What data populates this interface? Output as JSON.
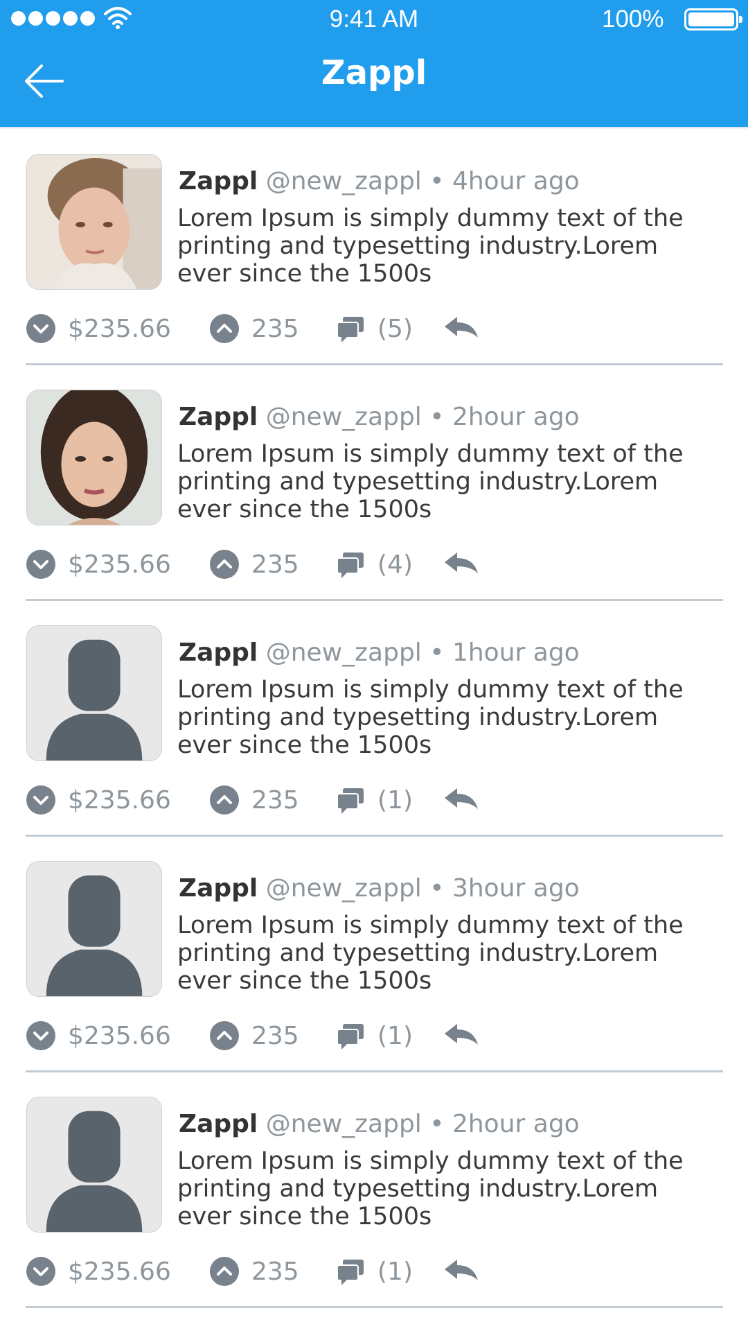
{
  "status_bar": {
    "time": "9:41 AM",
    "battery": "100%",
    "icons": [
      "signal-dots-icon",
      "wifi-icon",
      "battery-icon"
    ]
  },
  "header": {
    "title": "Zappl",
    "back_icon": "arrow-left-icon"
  },
  "colors": {
    "accent": "#219ded",
    "muted": "#8d969d",
    "text": "#3a3a3a",
    "divider": "#c3cbd2"
  },
  "posts": [
    {
      "avatar": "photo-woman-1",
      "name": "Zappl",
      "handle": "@new_zappl",
      "separator": "•",
      "time": "4hour ago",
      "text": "Lorem Ipsum is simply dummy text of the printing and typesetting industry.Lorem ever since the 1500s",
      "price": "$235.66",
      "votes": "235",
      "comments": "(5)"
    },
    {
      "avatar": "photo-woman-2",
      "name": "Zappl",
      "handle": "@new_zappl",
      "separator": "•",
      "time": "2hour ago",
      "text": "Lorem Ipsum is simply dummy text of the printing and typesetting industry.Lorem ever since the 1500s",
      "price": "$235.66",
      "votes": "235",
      "comments": "(4)"
    },
    {
      "avatar": "default-user-silhouette",
      "name": "Zappl",
      "handle": "@new_zappl",
      "separator": "•",
      "time": "1hour ago",
      "text": "Lorem Ipsum is simply dummy text of the printing and typesetting industry.Lorem ever since the 1500s",
      "price": "$235.66",
      "votes": "235",
      "comments": "(1)"
    },
    {
      "avatar": "default-user-silhouette",
      "name": "Zappl",
      "handle": "@new_zappl",
      "separator": "•",
      "time": "3hour ago",
      "text": "Lorem Ipsum is simply dummy text of the printing and typesetting industry.Lorem ever since the 1500s",
      "price": "$235.66",
      "votes": "235",
      "comments": "(1)"
    },
    {
      "avatar": "default-user-silhouette",
      "name": "Zappl",
      "handle": "@new_zappl",
      "separator": "•",
      "time": "2hour ago",
      "text": "Lorem Ipsum is simply dummy text of the printing and typesetting industry.Lorem ever since the 1500s",
      "price": "$235.66",
      "votes": "235",
      "comments": "(1)"
    }
  ]
}
